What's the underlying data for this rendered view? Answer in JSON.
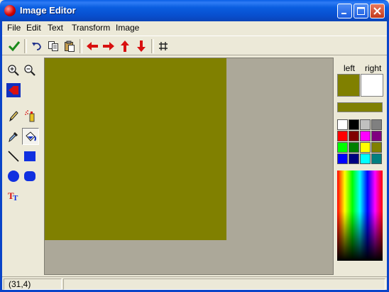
{
  "window": {
    "title": "Image Editor"
  },
  "menu": [
    "File",
    "Edit",
    "Text",
    "Transform",
    "Image"
  ],
  "toolbar": {
    "buttons": [
      "check-icon",
      "undo-icon",
      "copy-icon",
      "paste-icon",
      "arrow-left-icon",
      "arrow-right-icon",
      "arrow-up-icon",
      "arrow-down-icon",
      "grid-icon"
    ]
  },
  "tools": [
    "zoom-in",
    "zoom-out",
    "color-swap",
    "pencil",
    "spray",
    "eyedropper",
    "fill-bucket",
    "line",
    "rectangle",
    "ellipse",
    "rounded-rectangle",
    "text"
  ],
  "selected_tool": "fill-bucket",
  "colors": {
    "left_color": "#808000",
    "right_color": "#ffffff",
    "canvas_fill": "#808000",
    "canvas_bg": "#aca899"
  },
  "palette": {
    "left_label": "left",
    "right_label": "right",
    "swatches": [
      "#ffffff",
      "#000000",
      "#c0c0c0",
      "#808080",
      "#ff0000",
      "#800000",
      "#ff00ff",
      "#800080",
      "#00ff00",
      "#008000",
      "#ffff00",
      "#808000",
      "#0000ff",
      "#000080",
      "#00ffff",
      "#008080"
    ]
  },
  "status": {
    "position": "(31,4)",
    "message": ""
  }
}
